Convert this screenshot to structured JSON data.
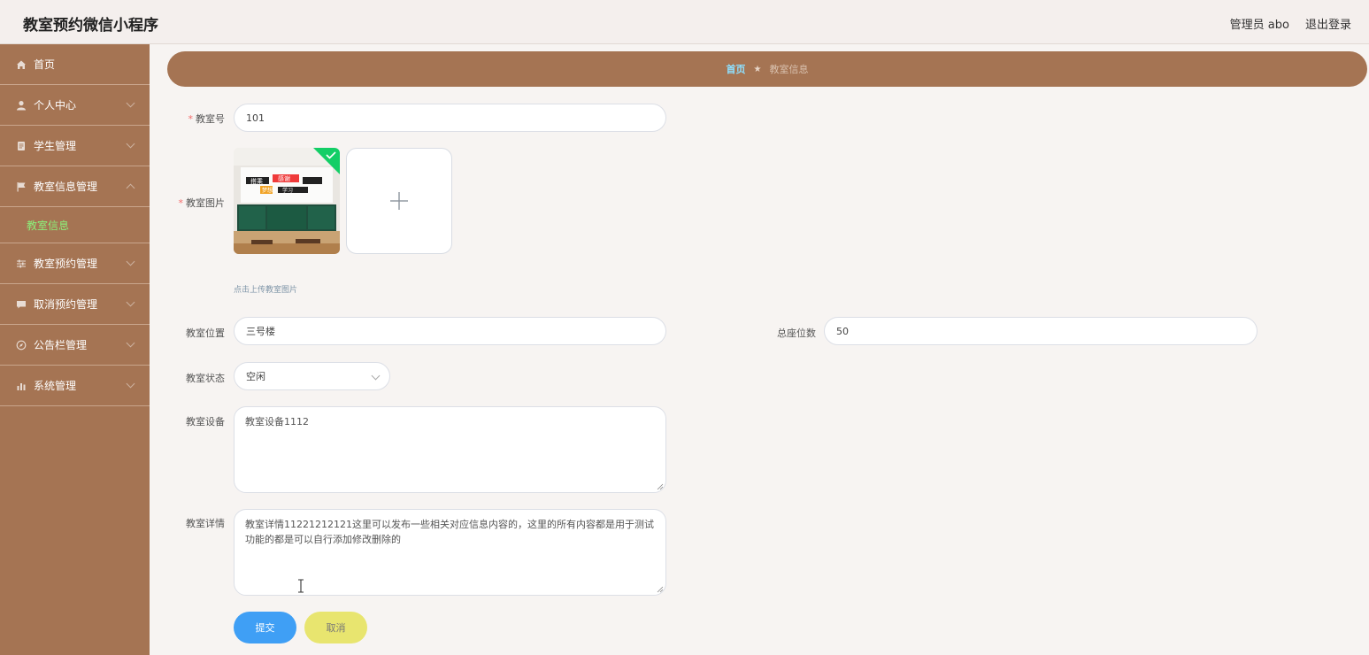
{
  "header": {
    "app_title": "教室预约微信小程序",
    "user_label": "管理员 abo",
    "logout_label": "退出登录"
  },
  "sidebar": {
    "items": [
      {
        "label": "首页",
        "icon": "home-icon"
      },
      {
        "label": "个人中心",
        "icon": "user-icon"
      },
      {
        "label": "学生管理",
        "icon": "document-icon"
      },
      {
        "label": "教室信息管理",
        "icon": "flag-icon"
      },
      {
        "label": "教室预约管理",
        "icon": "sliders-icon"
      },
      {
        "label": "取消预约管理",
        "icon": "message-icon"
      },
      {
        "label": "公告栏管理",
        "icon": "compass-icon"
      },
      {
        "label": "系统管理",
        "icon": "chart-icon"
      }
    ],
    "active_sub_item": "教室信息"
  },
  "breadcrumb": {
    "home": "首页",
    "separator": "★",
    "current": "教室信息"
  },
  "form": {
    "room_number": {
      "label": "教室号",
      "value": "101"
    },
    "room_image": {
      "label": "教室图片",
      "hint": "点击上传教室图片",
      "preview_text_1": "搭乘",
      "preview_text_2": "感谢",
      "preview_text_3": "梦想",
      "preview_text_4": "学习"
    },
    "location": {
      "label": "教室位置",
      "value": "三号楼"
    },
    "seats": {
      "label": "总座位数",
      "value": "50"
    },
    "status": {
      "label": "教室状态",
      "value": "空闲"
    },
    "equipment": {
      "label": "教室设备",
      "value": "教室设备1112"
    },
    "details": {
      "label": "教室详情",
      "value": "教室详情11221212121这里可以发布一些相关对应信息内容的，这里的所有内容都是用于测试功能的都是可以自行添加修改删除的"
    },
    "submit_label": "提交",
    "cancel_label": "取消"
  },
  "colors": {
    "sidebar_bg": "#a57453",
    "accent_blue": "#3f9ff5",
    "accent_yellow": "#e8e56f",
    "active_green": "#8cf07a",
    "required_red": "#f56c6c"
  }
}
